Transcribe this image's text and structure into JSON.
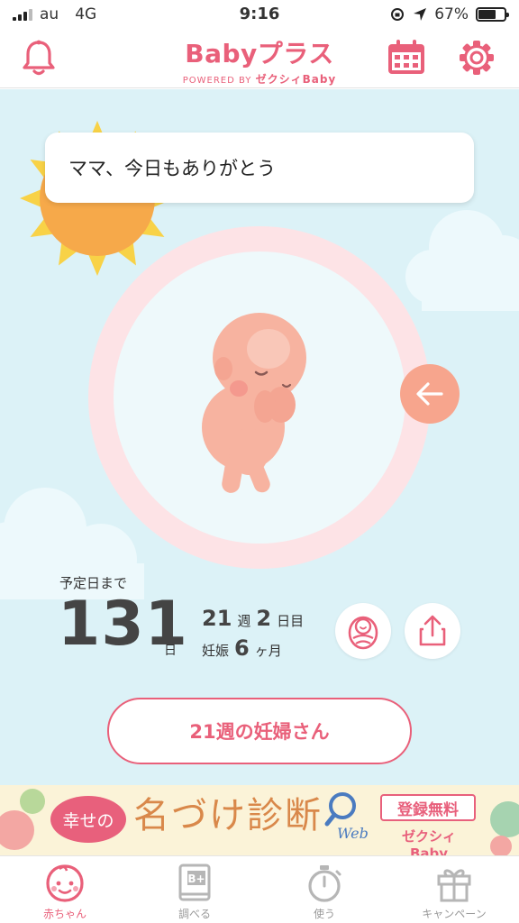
{
  "status_bar": {
    "carrier": "au",
    "network": "4G",
    "time": "9:16",
    "battery": "67%",
    "battery_level": 0.67
  },
  "header": {
    "logo_main": "Babyプラス",
    "logo_powered": "POWERED BY",
    "logo_brand": "ゼクシィBaby"
  },
  "main": {
    "message": "ママ、今日もありがとう",
    "due_label": "予定日まで",
    "days_left": "131",
    "days_unit": "日",
    "weeks": "21",
    "weeks_unit": "週",
    "extra_days": "2",
    "extra_days_unit": "日目",
    "pregnancy_label": "妊娠",
    "months": "6",
    "months_unit": "ヶ月",
    "week_button": "21週の妊婦さん"
  },
  "banner": {
    "bubble_text": "幸せの",
    "title": "名づけ診断",
    "web_text": "Web",
    "cta": "登録無料",
    "brand": "ゼクシィBaby"
  },
  "tabs": [
    {
      "label": "赤ちゃん",
      "icon": "baby-face-icon",
      "active": true
    },
    {
      "label": "調べる",
      "icon": "book-icon",
      "active": false
    },
    {
      "label": "使う",
      "icon": "stopwatch-icon",
      "active": false
    },
    {
      "label": "キャンペーン",
      "icon": "gift-icon",
      "active": false
    }
  ],
  "colors": {
    "accent": "#e9607a",
    "sky": "#dcf2f7",
    "back_button": "#f7a58d"
  }
}
